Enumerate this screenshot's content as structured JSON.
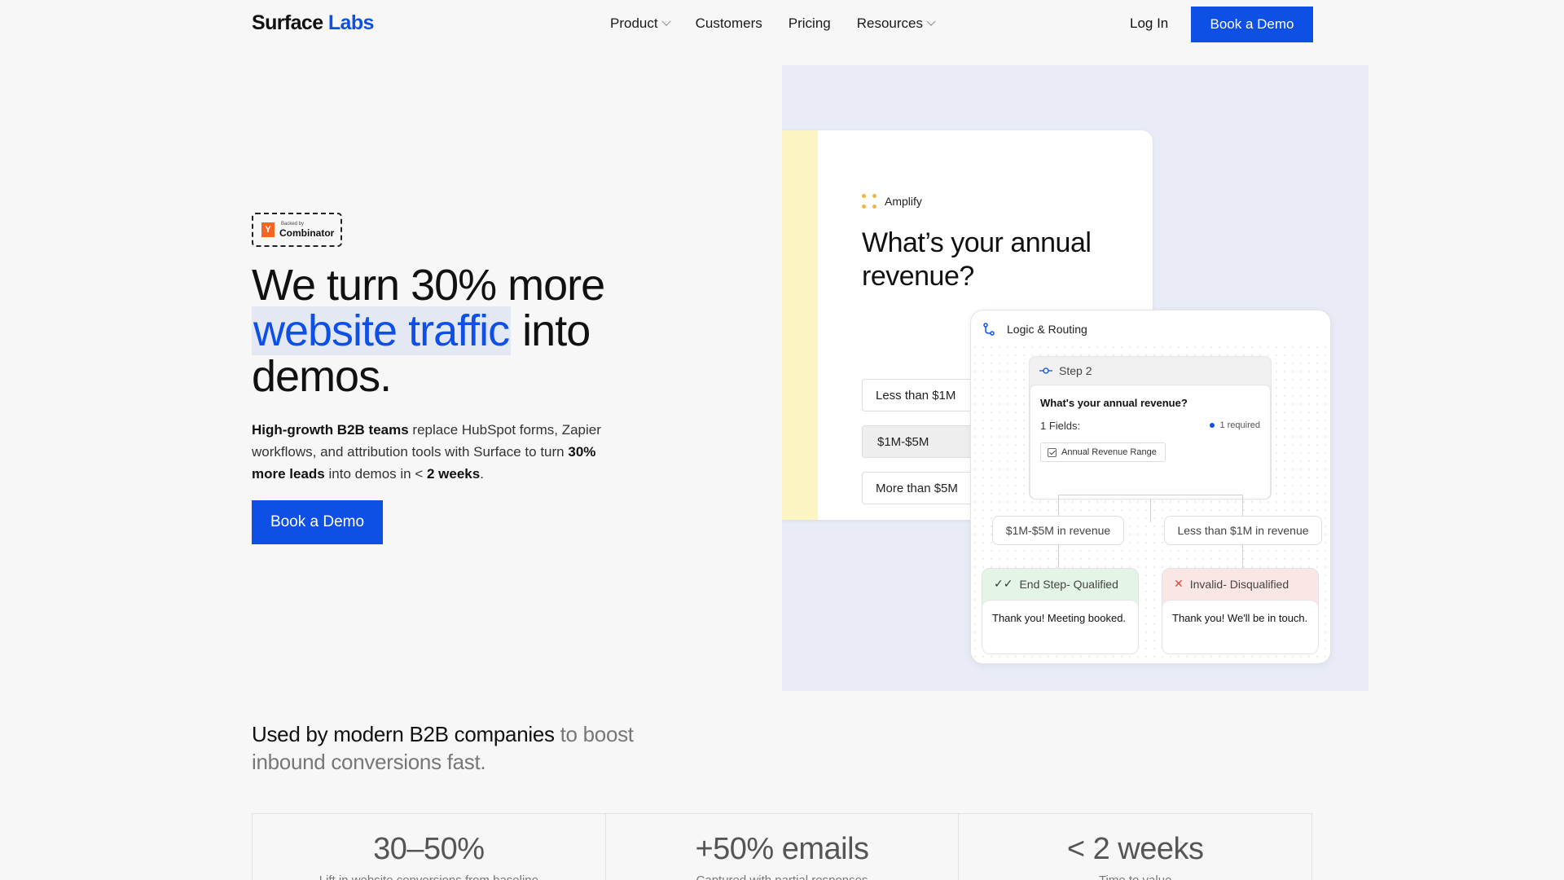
{
  "nav": {
    "logo_part1": "Surface",
    "logo_part2": "Labs",
    "links": [
      {
        "label": "Product",
        "has_dropdown": true
      },
      {
        "label": "Customers",
        "has_dropdown": false
      },
      {
        "label": "Pricing",
        "has_dropdown": false
      },
      {
        "label": "Resources",
        "has_dropdown": true
      }
    ],
    "login_label": "Log In",
    "cta_label": "Book a Demo"
  },
  "hero": {
    "badge_small": "Backed by",
    "badge_logo_letter": "Y",
    "badge_big": "Combinator",
    "headline_part1": "We turn 30% more",
    "headline_highlight": "website traffic",
    "headline_part2": " into demos.",
    "sub_bold1": "High-growth B2B teams",
    "sub_text1": " replace HubSpot forms, Zapier workflows, and attribution tools with Surface to turn ",
    "sub_bold2": "30% more leads",
    "sub_text2": " into demos in < ",
    "sub_bold3": "2 weeks",
    "sub_text3": ".",
    "cta_label": "Book a Demo"
  },
  "illustration": {
    "form": {
      "brand": "Amplify",
      "question": "What’s your annual revenue?",
      "options": [
        "Less than $1M",
        "$1M-$5M",
        "More than $5M"
      ],
      "selected_index": 1
    },
    "logic": {
      "title": "Logic & Routing",
      "step_label": "Step 2",
      "step_question": "What's your annual revenue?",
      "fields_label": "1 Fields:",
      "required_label": "1 required",
      "field_tag": "Annual Revenue Range",
      "branches": [
        "$1M-$5M in revenue",
        "Less than $1M in revenue"
      ],
      "ends": [
        {
          "title": "End Step- Qualified",
          "body": "Thank you! Meeting booked."
        },
        {
          "title": "Invalid- Disqualified",
          "body": "Thank you! We'll be in touch."
        }
      ]
    }
  },
  "used_by": {
    "dark": "Used by modern B2B companies",
    "muted": " to boost inbound conversions fast."
  },
  "stats": [
    {
      "value": "30–50%",
      "desc": "Lift in website conversions from baseline"
    },
    {
      "value": "+50% emails",
      "desc": "Captured with partial responses"
    },
    {
      "value": "< 2 weeks",
      "desc": "Time to value"
    }
  ],
  "colors": {
    "accent": "#0e50e6",
    "illustration_bg": "#e9ecf6",
    "form_strip": "#fdf4c4",
    "qualified_bg": "#e4f5e7",
    "disqualified_bg": "#fbe6e6"
  }
}
